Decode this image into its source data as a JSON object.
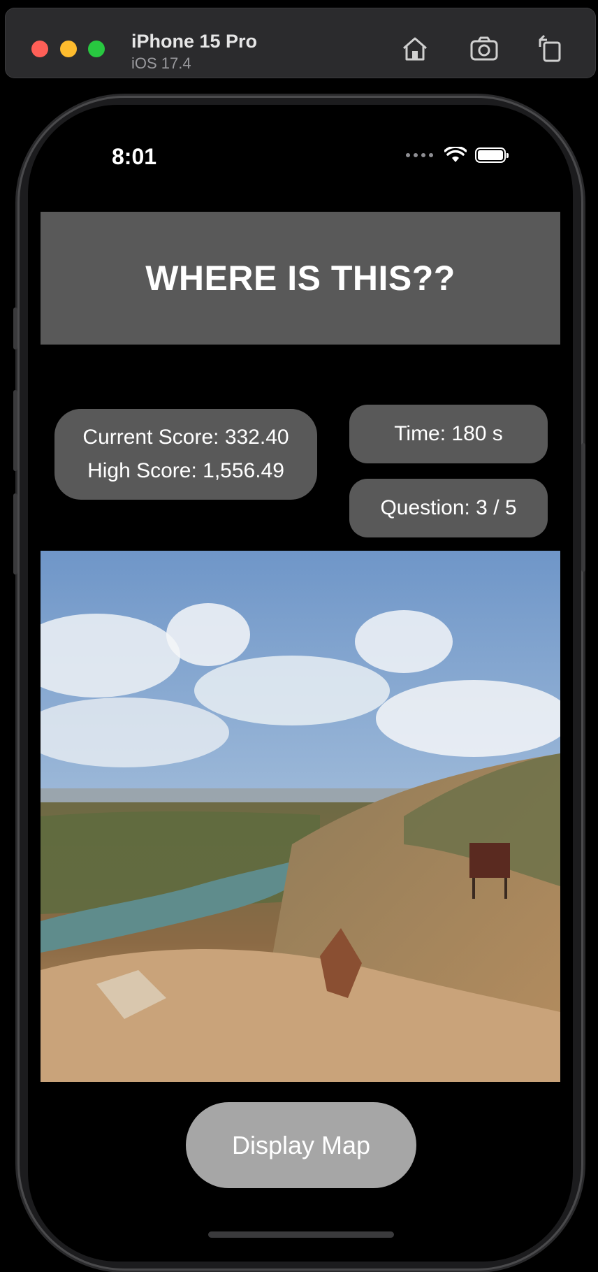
{
  "simulator": {
    "device_name": "iPhone 15 Pro",
    "os_version": "iOS 17.4",
    "buttons": [
      "home-icon",
      "screenshot-icon",
      "rotate-icon"
    ]
  },
  "status_bar": {
    "time": "8:01"
  },
  "header": {
    "title": "WHERE IS THIS??"
  },
  "stats": {
    "current_score": "Current Score: 332.40",
    "high_score": "High Score: 1,556.49",
    "time": "Time: 180 s",
    "question": "Question: 3 / 5"
  },
  "main": {
    "photo_icon": "landscape-photo"
  },
  "actions": {
    "display_map_label": "Display Map"
  },
  "colors": {
    "panel": "#595959",
    "button": "#a6a6a6",
    "background": "#000000"
  }
}
